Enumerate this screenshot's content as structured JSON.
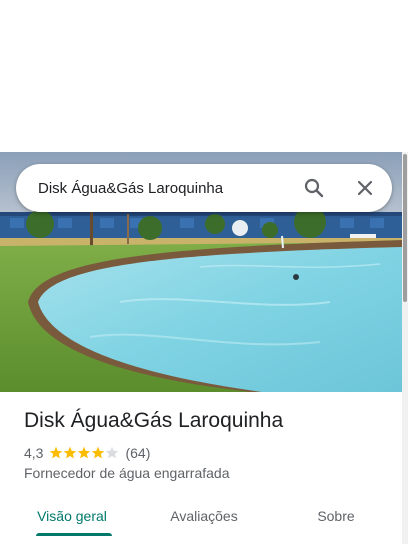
{
  "search": {
    "value": "Disk Água&Gás Laroquinha",
    "search_icon": "search-icon",
    "close_icon": "close-icon"
  },
  "place": {
    "name": "Disk Água&Gás Laroquinha",
    "rating": "4,3",
    "rating_stars": 4.3,
    "review_count": "(64)",
    "category": "Fornecedor de água engarrafada"
  },
  "tabs": [
    {
      "label": "Visão geral",
      "active": true
    },
    {
      "label": "Avaliações",
      "active": false
    },
    {
      "label": "Sobre",
      "active": false
    }
  ],
  "colors": {
    "accent": "#00796b",
    "star": "#fbbc04",
    "pool_water": "#7fd3e3",
    "lawn": "#6fa33a"
  }
}
